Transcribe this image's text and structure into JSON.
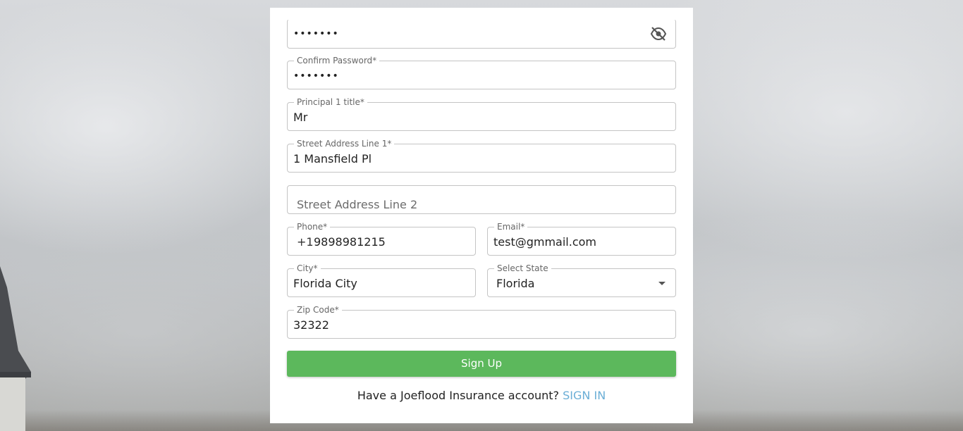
{
  "form": {
    "password": {
      "value": "•••••••",
      "icon": "eye-off-icon"
    },
    "confirm_password": {
      "label": "Confirm Password*",
      "value": "•••••••"
    },
    "principal_title": {
      "label": "Principal 1 title*",
      "value": "Mr"
    },
    "street1": {
      "label": "Street Address Line 1*",
      "value": "1 Mansfield Pl"
    },
    "street2": {
      "placeholder": "Street Address Line 2"
    },
    "phone": {
      "label": "Phone*",
      "prefix": "+1",
      "value": "9898981215"
    },
    "email": {
      "label": "Email*",
      "value": "test@gmmail.com"
    },
    "city": {
      "label": "City*",
      "value": "Florida City"
    },
    "state": {
      "label": "Select State",
      "value": "Florida",
      "icon": "caret-down-icon"
    },
    "zip": {
      "label": "Zip Code*",
      "value": "32322"
    }
  },
  "actions": {
    "signup_label": "Sign Up",
    "account_prompt": "Have a Joeflood Insurance account?",
    "signin_label": "SIGN IN"
  },
  "colors": {
    "button": "#5cb85c",
    "link": "#6aaed6",
    "border": "#c4c4c4"
  }
}
